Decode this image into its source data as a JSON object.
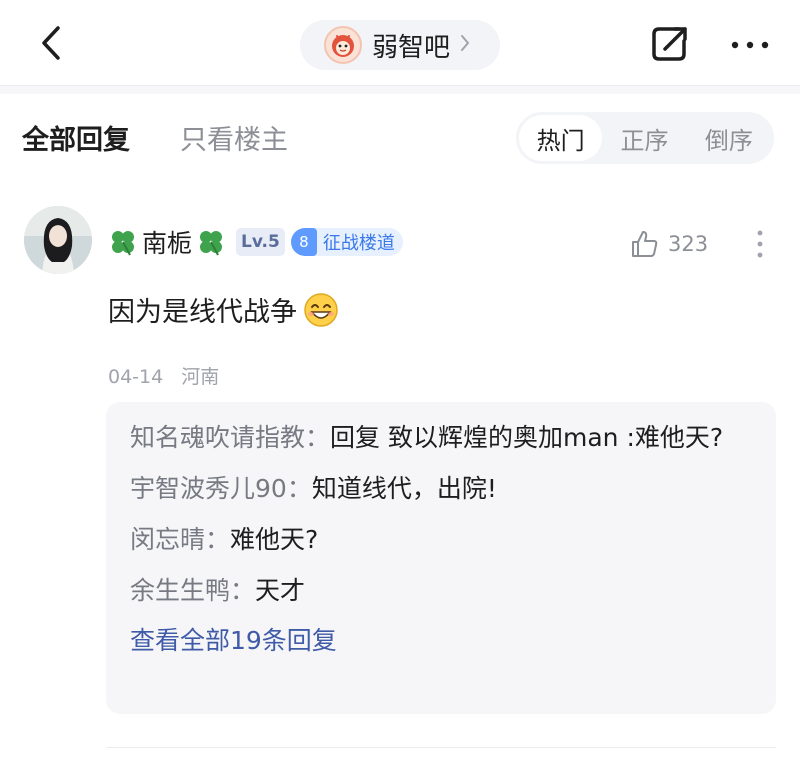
{
  "header": {
    "forum_name": "弱智吧",
    "back_icon": "back-chevron-icon",
    "edit_icon": "share-edit-icon",
    "more_icon": "more-dots-icon"
  },
  "filters": {
    "all_replies": "全部回复",
    "op_only": "只看楼主",
    "sort": {
      "hot": "热门",
      "asc": "正序",
      "desc": "倒序",
      "selected": "热门"
    }
  },
  "comment": {
    "username": "南栀",
    "level": "Lv.5",
    "badge_num": "8",
    "badge_text": "征战楼道",
    "likes": "323",
    "text": "因为是线代战争",
    "date": "04-14",
    "location": "河南",
    "replies": [
      {
        "name": "知名魂吹请指教",
        "sep": "：",
        "text": "回复 致以辉煌的奥加man :难他天?"
      },
      {
        "name": "宇智波秀儿90",
        "sep": "：",
        "text": "知道线代，出院!"
      },
      {
        "name": "闵忘晴",
        "sep": "：",
        "text": "难他天?"
      },
      {
        "name": "余生生鸭",
        "sep": "：",
        "text": "天才"
      }
    ],
    "view_all": "查看全部19条回复"
  },
  "colors": {
    "link": "#3f5ba8",
    "badge_blue": "#3b79e8",
    "muted": "#8c8f96"
  }
}
